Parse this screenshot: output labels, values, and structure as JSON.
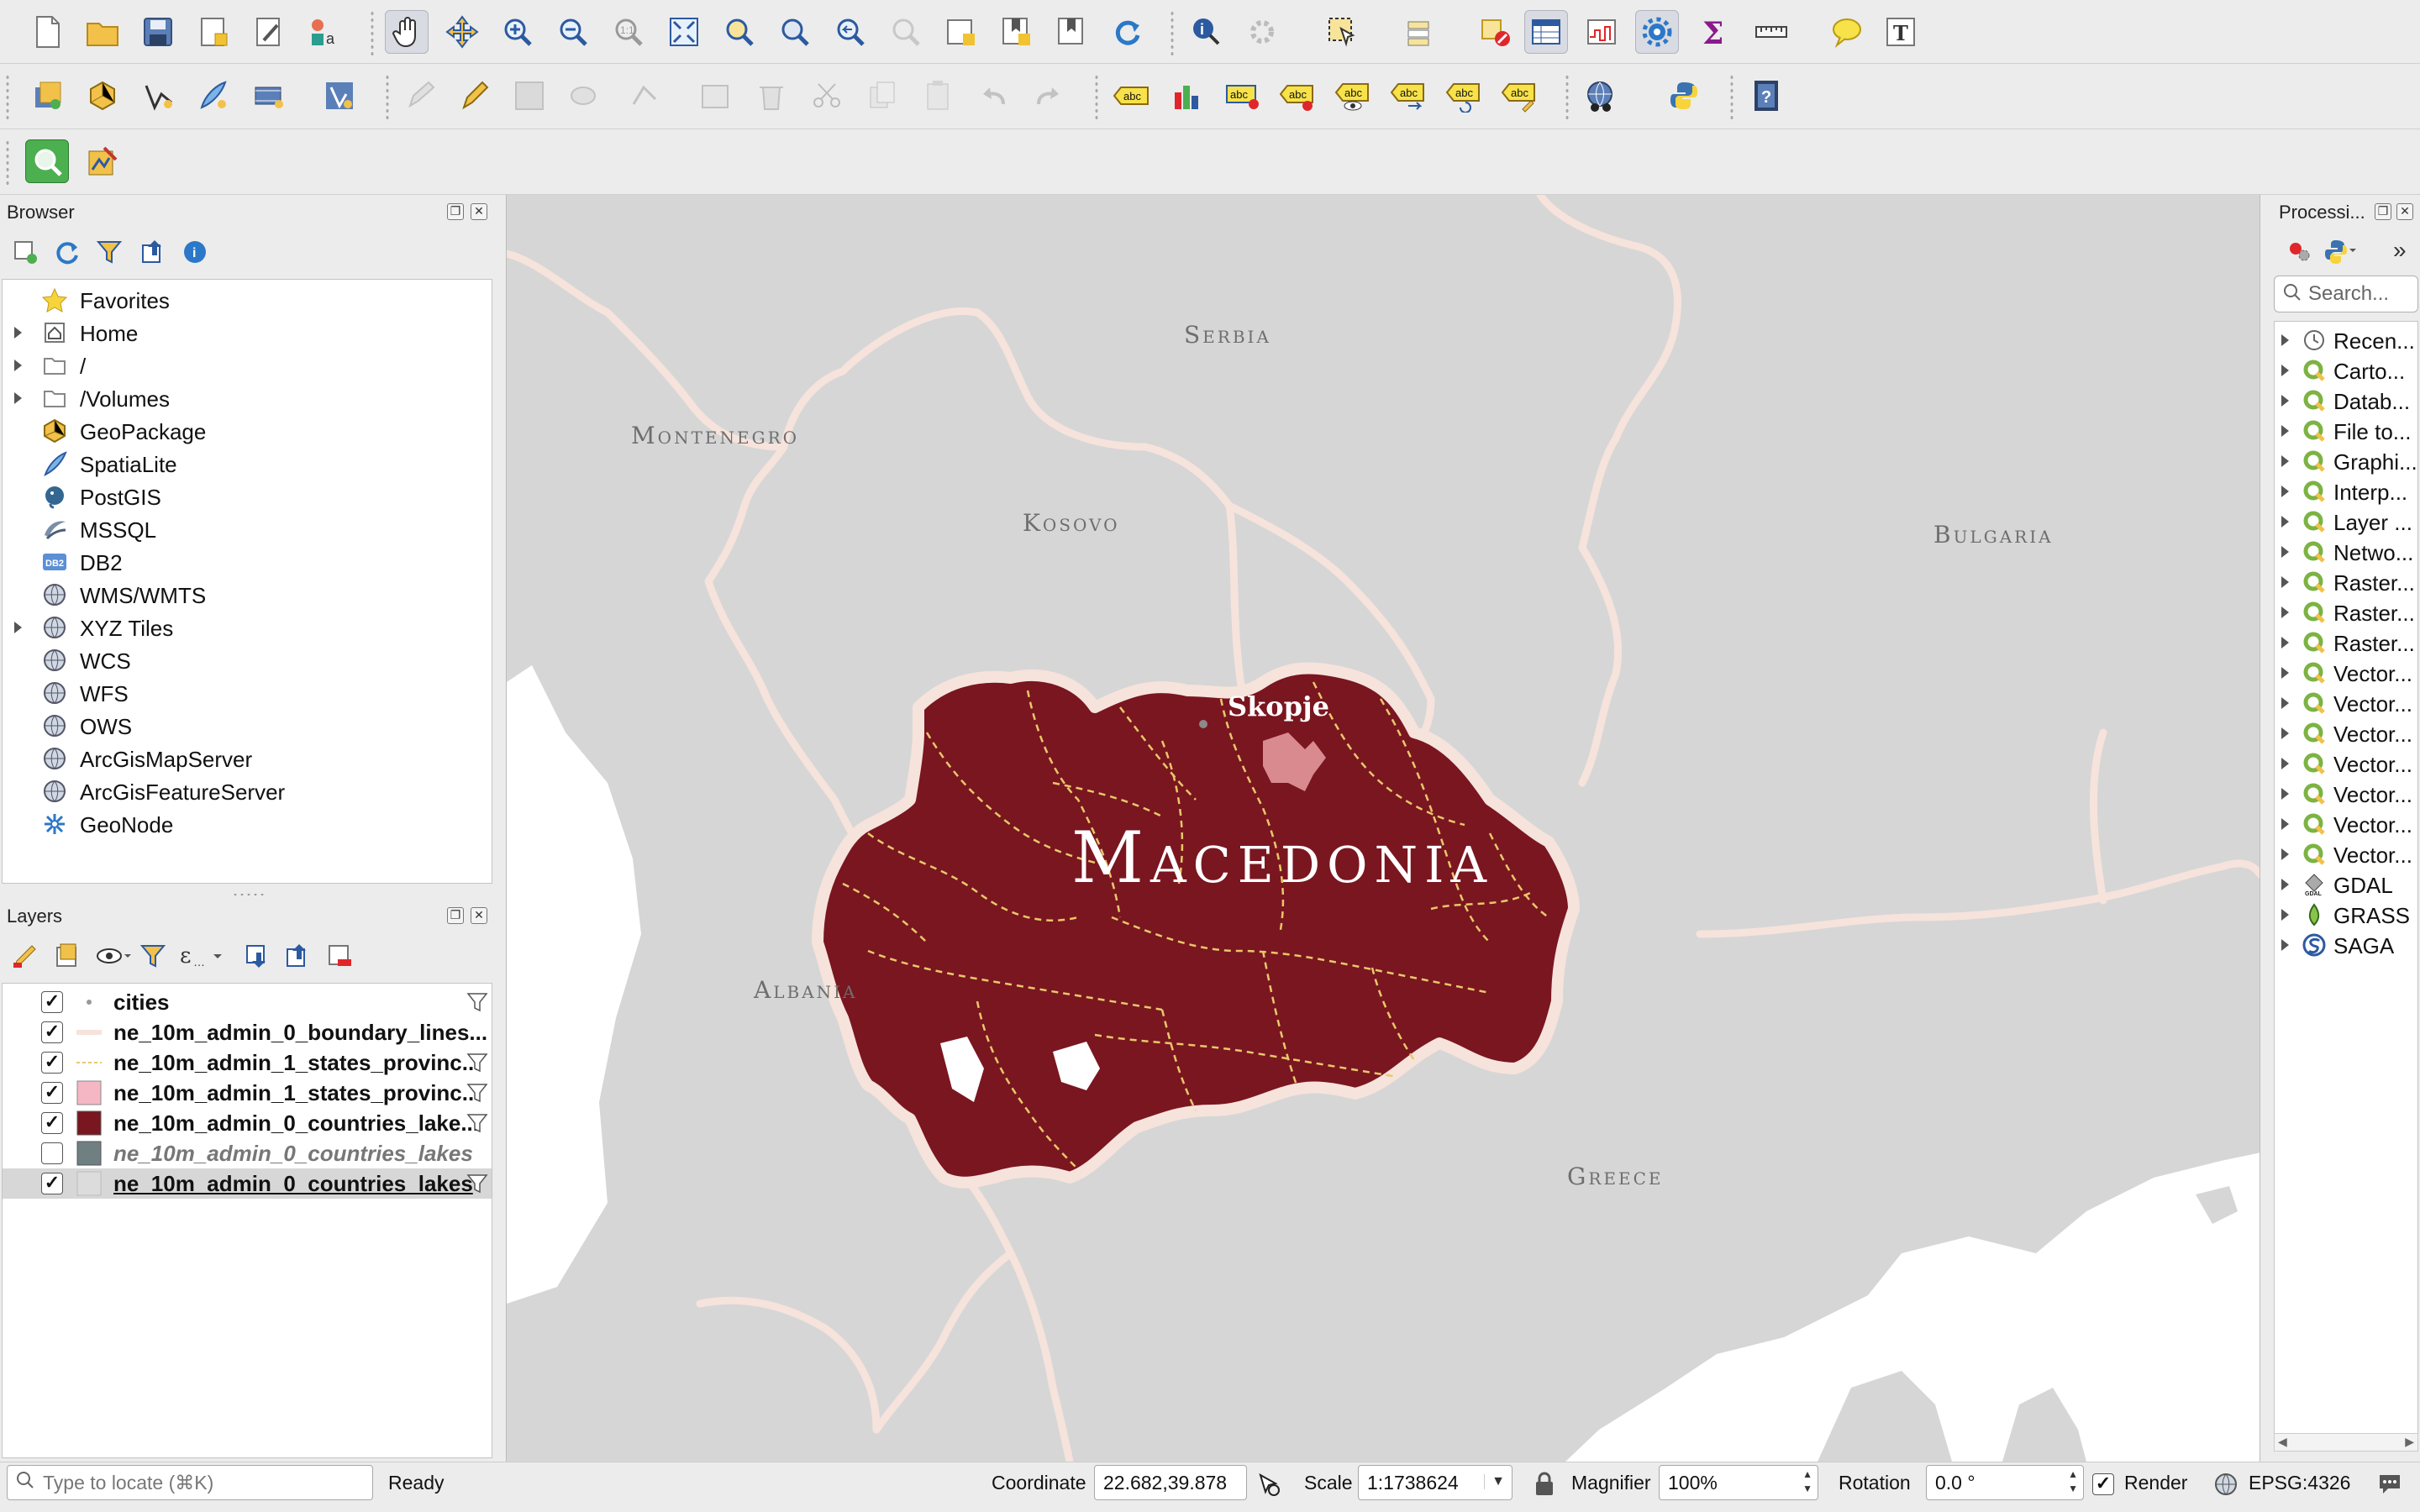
{
  "browser": {
    "title": "Browser",
    "items": [
      {
        "label": "Favorites",
        "expand": false,
        "icon": "star-icon"
      },
      {
        "label": "Home",
        "expand": true,
        "icon": "home-icon"
      },
      {
        "label": "/",
        "expand": true,
        "icon": "folder-icon"
      },
      {
        "label": "/Volumes",
        "expand": true,
        "icon": "folder-icon"
      },
      {
        "label": "GeoPackage",
        "expand": false,
        "icon": "geopackage-icon"
      },
      {
        "label": "SpatiaLite",
        "expand": false,
        "icon": "spatialite-icon"
      },
      {
        "label": "PostGIS",
        "expand": false,
        "icon": "postgis-icon"
      },
      {
        "label": "MSSQL",
        "expand": false,
        "icon": "mssql-icon"
      },
      {
        "label": "DB2",
        "expand": false,
        "icon": "db2-icon"
      },
      {
        "label": "WMS/WMTS",
        "expand": false,
        "icon": "globe-icon"
      },
      {
        "label": "XYZ Tiles",
        "expand": true,
        "icon": "globe-icon"
      },
      {
        "label": "WCS",
        "expand": false,
        "icon": "globe-icon"
      },
      {
        "label": "WFS",
        "expand": false,
        "icon": "globe-icon"
      },
      {
        "label": "OWS",
        "expand": false,
        "icon": "globe-icon"
      },
      {
        "label": "ArcGisMapServer",
        "expand": false,
        "icon": "globe-icon"
      },
      {
        "label": "ArcGisFeatureServer",
        "expand": false,
        "icon": "globe-icon"
      },
      {
        "label": "GeoNode",
        "expand": false,
        "icon": "geonode-icon"
      }
    ],
    "db2_icon_text": "DB2"
  },
  "layers": {
    "title": "Layers",
    "items": [
      {
        "label": "cities",
        "checked": true,
        "symbol": "point",
        "filter": true,
        "style": "bold"
      },
      {
        "label": "ne_10m_admin_0_boundary_lines...",
        "checked": true,
        "symbol": "line-light",
        "filter": false,
        "style": "bold"
      },
      {
        "label": "ne_10m_admin_1_states_provinc...",
        "checked": true,
        "symbol": "line-dashed",
        "filter": true,
        "style": "bold"
      },
      {
        "label": "ne_10m_admin_1_states_provinc...",
        "checked": true,
        "symbol": "fill-pink",
        "filter": true,
        "style": "bold"
      },
      {
        "label": "ne_10m_admin_0_countries_lake...",
        "checked": true,
        "symbol": "fill-maroon",
        "filter": true,
        "style": "bold"
      },
      {
        "label": "ne_10m_admin_0_countries_lakes",
        "checked": false,
        "symbol": "fill-slate",
        "filter": false,
        "style": "italic"
      },
      {
        "label": "ne_10m_admin_0_countries_lakes",
        "checked": true,
        "symbol": "fill-light",
        "filter": true,
        "style": "selected"
      }
    ]
  },
  "processing": {
    "title": "Processi...",
    "search_placeholder": "Search...",
    "items": [
      {
        "label": "Recen...",
        "icon": "clock-icon"
      },
      {
        "label": "Carto...",
        "icon": "qgis-icon"
      },
      {
        "label": "Datab...",
        "icon": "qgis-icon"
      },
      {
        "label": "File to...",
        "icon": "qgis-icon"
      },
      {
        "label": "Graphi...",
        "icon": "qgis-icon"
      },
      {
        "label": "Interp...",
        "icon": "qgis-icon"
      },
      {
        "label": "Layer ...",
        "icon": "qgis-icon"
      },
      {
        "label": "Netwo...",
        "icon": "qgis-icon"
      },
      {
        "label": "Raster...",
        "icon": "qgis-icon"
      },
      {
        "label": "Raster...",
        "icon": "qgis-icon"
      },
      {
        "label": "Raster...",
        "icon": "qgis-icon"
      },
      {
        "label": "Vector...",
        "icon": "qgis-icon"
      },
      {
        "label": "Vector...",
        "icon": "qgis-icon"
      },
      {
        "label": "Vector...",
        "icon": "qgis-icon"
      },
      {
        "label": "Vector...",
        "icon": "qgis-icon"
      },
      {
        "label": "Vector...",
        "icon": "qgis-icon"
      },
      {
        "label": "Vector...",
        "icon": "qgis-icon"
      },
      {
        "label": "Vector...",
        "icon": "qgis-icon"
      },
      {
        "label": "GDAL",
        "icon": "gdal-icon"
      },
      {
        "label": "GRASS",
        "icon": "grass-icon"
      },
      {
        "label": "SAGA",
        "icon": "saga-icon"
      }
    ]
  },
  "map": {
    "labels": {
      "serbia": "Serbia",
      "montenegro": "Montenegro",
      "kosovo": "Kosovo",
      "bulgaria": "Bulgaria",
      "albania": "Albania",
      "greece": "Greece",
      "macedonia": "Macedonia",
      "skopje": "Skopje"
    },
    "colors": {
      "background": "#d6d6d6",
      "highlight_country": "#7a1620",
      "boundary": "#f6e3dc",
      "water": "#ffffff",
      "capital": "#d98a8f",
      "province_lines": "#e8c86a"
    }
  },
  "status": {
    "locate_placeholder": "Type to locate (⌘K)",
    "ready": "Ready",
    "coordinate_label": "Coordinate",
    "coordinate_value": "22.682,39.878",
    "scale_label": "Scale",
    "scale_value": "1:1738624",
    "magnifier_label": "Magnifier",
    "magnifier_value": "100%",
    "rotation_label": "Rotation",
    "rotation_value": "0.0 °",
    "render_label": "Render",
    "render_checked": true,
    "crs": "EPSG:4326"
  }
}
